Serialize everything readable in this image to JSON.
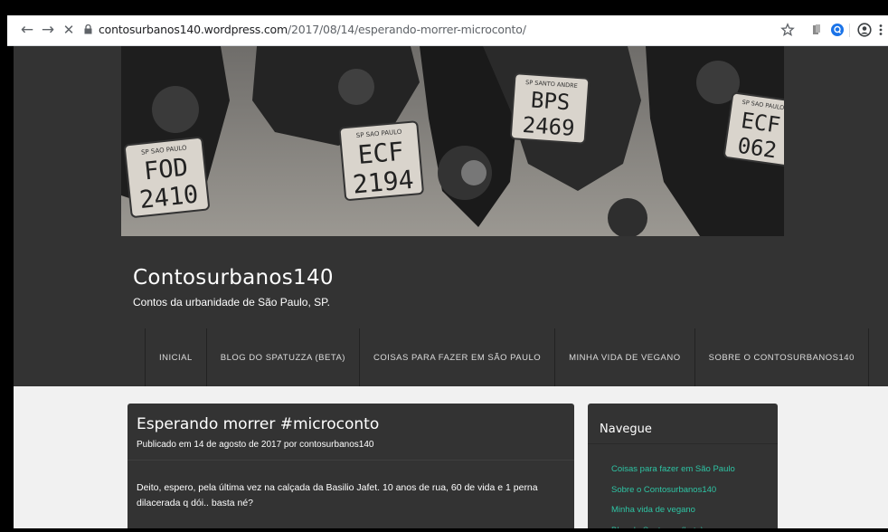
{
  "browser": {
    "url_host": "contosurbanos140.wordpress.com",
    "url_path": "/2017/08/14/esperando-morrer-microconto/",
    "icons": [
      "back-arrow-icon",
      "forward-arrow-icon",
      "close-icon",
      "lock-icon",
      "star-icon",
      "extension-icon",
      "profile-icon",
      "account-icon",
      "kebab-menu-icon"
    ],
    "back_glyph": "←",
    "forward_glyph": "→",
    "stop_glyph": "✕"
  },
  "header": {
    "plates": [
      "FOD 2410",
      "ECF 2194",
      "BPS 2469",
      "ECF 062"
    ],
    "plate_small_text": [
      "SP SAO PAULO",
      "SP SAO PAULO",
      "SP SANTO ANDRE",
      "SP SAO PAULO"
    ],
    "site_title": "Contosurbanos140",
    "site_description": "Contos da urbanidade de São Paulo, SP."
  },
  "menu": {
    "items": [
      {
        "label": "Inicial"
      },
      {
        "label": "Blog do Spatuzza (beta)"
      },
      {
        "label": "Coisas para fazer em São Paulo"
      },
      {
        "label": "Minha vida de vegano"
      },
      {
        "label": "Sobre o Contosurbanos140"
      }
    ]
  },
  "post": {
    "title": "Esperando morrer #microconto",
    "meta_prefix": "Publicado em",
    "date": "14 de agosto de 2017",
    "meta_by": "por",
    "author": "contosurbanos140",
    "body": "Deito, espero, pela última vez na calçada da Basilio Jafet. 10 anos de rua, 60 de vida e 1 perna dilacerada q dói.. basta né?"
  },
  "sidebar": {
    "title": "Navegue",
    "links": [
      "Coisas para fazer em São Paulo",
      "Sobre o Contosurbanos140",
      "Minha vida de vegano",
      "Blog do Spatuzza (beta)"
    ]
  },
  "colors": {
    "header_bg": "#333333",
    "page_bg": "#f1f1f1",
    "link_accent": "#2ec4a4"
  }
}
